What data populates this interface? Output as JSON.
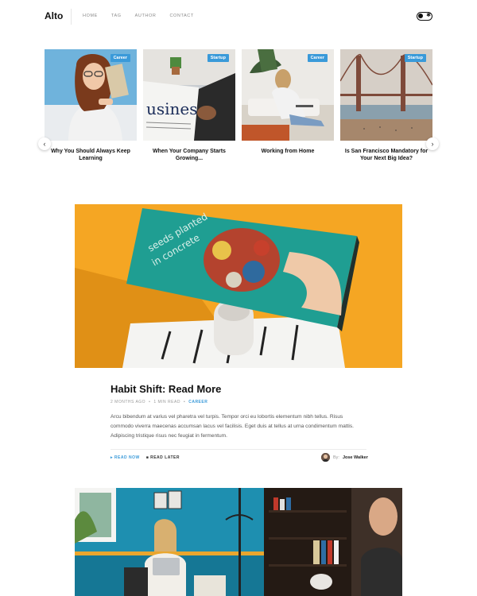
{
  "site": {
    "logo": "Alto"
  },
  "nav": {
    "items": [
      "HOME",
      "TAG",
      "AUTHOR",
      "CONTACT"
    ]
  },
  "theme_toggle": {
    "icon": "moon-star-toggle"
  },
  "carousel": {
    "prev_icon": "chevron-left-icon",
    "next_icon": "chevron-right-icon",
    "cards": [
      {
        "category": "Career",
        "title": "Why You Should Always Keep Learning"
      },
      {
        "category": "Startup",
        "title": "When Your Company Starts Growing..."
      },
      {
        "category": "Career",
        "title": "Working from Home"
      },
      {
        "category": "Startup",
        "title": "Is San Francisco Mandatory for Your Next Big Idea?"
      }
    ]
  },
  "post": {
    "title": "Habit Shift: Read More",
    "date": "2 MONTHS AGO",
    "read_time": "1 MIN READ",
    "category": "CAREER",
    "separator": "•",
    "excerpt": "Arcu bibendum at varius vel pharetra vel turpis. Tempor orci eu lobortis elementum nibh tellus. Risus commodo viverra maecenas accumsan lacus vel facilisis. Eget duis at tellus at urna condimentum mattis. Adipiscing tristique risus nec feugiat in fermentum.",
    "read_now": "READ NOW",
    "read_later": "READ LATER",
    "author_prefix": "By:",
    "author": "Jose Walker",
    "hero_text_line1": "seeds planted",
    "hero_text_line2": "in concrete"
  },
  "colors": {
    "accent": "#3a9ad9",
    "hero_bg": "#f5a623",
    "book": "#1f9e92"
  }
}
